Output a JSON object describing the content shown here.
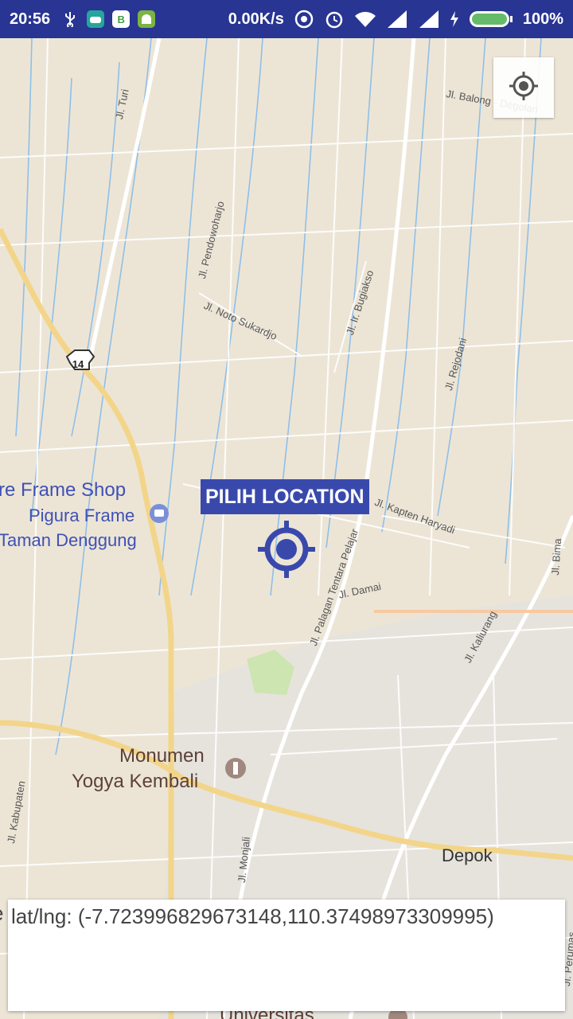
{
  "status_bar": {
    "time": "20:56",
    "notif_b": "B",
    "net_speed": "0.00K/s",
    "battery": "100%",
    "background": "#283593"
  },
  "map": {
    "road_labels": {
      "turi": "Jl. Turi",
      "balong": "Jl. Balong - Degolan",
      "pendowoharjo": "Jl. Pendowoharjo",
      "noto": "Jl. Noto Sukardjo",
      "bugiakso": "Jl. Ir. Bugiakso",
      "rejodani": "Jl. Rejodani",
      "kapten": "Jl. Kapten Haryadi",
      "palagan": "Jl. Palagan Tentara Pelajar",
      "damai": "Jl. Damai",
      "kaliurang": "Jl. Kaliurang",
      "bima": "Jl. Bima",
      "kabupaten": "Jl. Kabupaten",
      "monjali": "Jl. Monjali",
      "perumas": "Jl. Perumas"
    },
    "route_shield": "14",
    "places": {
      "frame_shop": "re Frame Shop",
      "pigura": "Pigura Frame",
      "taman": "Taman Denggung",
      "monumen1": "Monumen",
      "monumen2": "Yogya Kembali",
      "depok": "Depok",
      "univ": "Universitas"
    }
  },
  "picker": {
    "label": "PILIH LOCATION",
    "accent": "#3949ab"
  },
  "coordinates": {
    "text": "lat/lng: (-7.723996829673148,110.37498973309995)",
    "edge_char": "e"
  }
}
